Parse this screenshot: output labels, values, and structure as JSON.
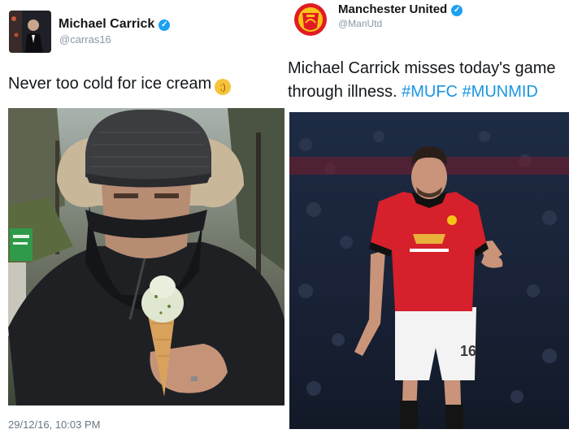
{
  "left_tweet": {
    "author_name": "Michael Carrick",
    "author_handle": "@carras16",
    "text": "Never too cold for ice cream",
    "emoji_icon": "winking-face-emoji",
    "timestamp": "29/12/16, 10:03 PM"
  },
  "right_tweet": {
    "author_name": "Manchester United",
    "author_handle": "@ManUtd",
    "text": "Michael Carrick misses today's game through illness.",
    "hashtags": [
      "#MUFC",
      "#MUNMID"
    ],
    "logo_text": "MANCHESTER UNITED"
  },
  "colors": {
    "verified": "#1da1f2",
    "hashtag": "#1b95e0",
    "text": "#14171a",
    "muted": "#8899a6"
  }
}
